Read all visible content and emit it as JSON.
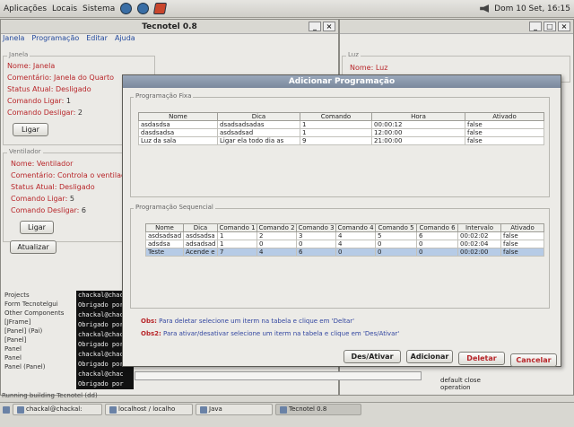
{
  "topbar": {
    "menus": [
      "Aplicações",
      "Locais",
      "Sistema"
    ],
    "clock": "Dom 10 Set, 16:15"
  },
  "main_window": {
    "title": "Tecnotel 0.8",
    "menu": [
      "Janela",
      "Programação",
      "Editar",
      "Ajuda"
    ],
    "janela": {
      "group_title": "Janela",
      "nome_label": "Nome:",
      "nome_value": "Janela",
      "comentario_label": "Comentário:",
      "comentario_value": "Janela do Quarto",
      "status_label": "Status Atual:",
      "status_value": "Desligado",
      "ligar_label": "Comando Ligar:",
      "ligar_value": "1",
      "desligar_label": "Comando Desligar:",
      "desligar_value": "2",
      "button": "Ligar"
    },
    "ventilador": {
      "group_title": "Ventilador",
      "nome_label": "Nome:",
      "nome_value": "Ventilador",
      "comentario_label": "Comentário:",
      "comentario_value": "Controla o ventilad",
      "status_label": "Status Atual:",
      "status_value": "Desligado",
      "ligar_label": "Comando Ligar:",
      "ligar_value": "5",
      "desligar_label": "Comando Desligar:",
      "desligar_value": "6",
      "button": "Ligar"
    },
    "atualizar_button": "Atualizar",
    "console_lines": [
      "chackal@chac",
      "Obrigado por",
      "chackal@chac",
      "Obrigado por",
      "chackal@chac",
      "Obrigado por",
      "chackal@chac",
      "Obrigado por",
      "chackal@chac",
      "Obrigado por"
    ],
    "tree_items": [
      "Projects",
      "Form Tecnotelgui",
      "Other Components",
      "[JFrame]",
      "[Panel] (Pai)",
      "[Panel]",
      "Panel",
      "Panel",
      "Panel (Panel)"
    ],
    "status_text": "Running building Tecnotel (dd)"
  },
  "right_window": {
    "group_title": "Luz",
    "nome_label": "Nome:",
    "nome_value": "Luz",
    "lines": [
      "default close",
      "operation"
    ]
  },
  "dialog": {
    "title": "Adicionar Programação",
    "fixa_group": "Programação Fixa",
    "fixa_columns": [
      "Nome",
      "Dica",
      "Comando",
      "Hora",
      "Ativado"
    ],
    "fixa_rows": [
      [
        "asdasdsa",
        "dsadsadsadas",
        "1",
        "00:00:12",
        "false"
      ],
      [
        "dasdsadsa",
        "asdsadsad",
        "1",
        "12:00:00",
        "false"
      ],
      [
        "Luz da sala",
        "Ligar ela todo dia as",
        "9",
        "21:00:00",
        "false"
      ]
    ],
    "seq_group": "Programação Sequencial",
    "seq_columns": [
      "Nome",
      "Dica",
      "Comando 1",
      "Comando 2",
      "Comando 3",
      "Comando 4",
      "Comando 5",
      "Comando 6",
      "Intervalo",
      "Ativado"
    ],
    "seq_rows": [
      [
        "asdsadsad",
        "asdsadsa",
        "1",
        "2",
        "3",
        "4",
        "5",
        "6",
        "00:02:02",
        "false"
      ],
      [
        "adsdsa",
        "adsadsad",
        "1",
        "0",
        "0",
        "4",
        "0",
        "0",
        "00:02:04",
        "false"
      ],
      [
        "Teste",
        "Acende e",
        "7",
        "4",
        "6",
        "0",
        "0",
        "0",
        "00:02:00",
        "false"
      ]
    ],
    "obs1_label": "Obs:",
    "obs1_text": "Para deletar selecione um iterm na tabela e clique em 'Deltar'",
    "obs2_label": "Obs2:",
    "obs2_text": "Para ativar/desativar selecione um iterm na tabela e clique em 'Des/Ativar'",
    "buttons": {
      "desativar": "Des/Ativar",
      "adicionar": "Adicionar",
      "deletar": "Deletar",
      "cancelar": "Cancelar"
    }
  },
  "taskbar": {
    "tasks": [
      "chackal@chackal:",
      "localhost / localho",
      "Java",
      "Tecnotel 0.8"
    ]
  }
}
